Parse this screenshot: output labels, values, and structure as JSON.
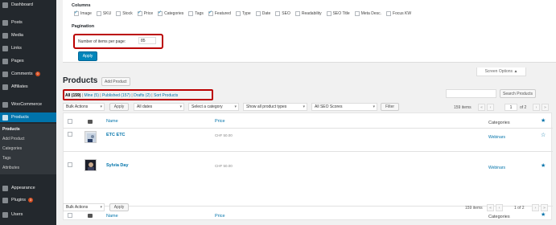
{
  "sidebar": {
    "items": [
      {
        "label": "Dashboard",
        "icon": "dashboard-icon"
      },
      {
        "label": "Posts",
        "icon": "pin-icon"
      },
      {
        "label": "Media",
        "icon": "media-icon"
      },
      {
        "label": "Links",
        "icon": "link-icon"
      },
      {
        "label": "Pages",
        "icon": "pages-icon"
      },
      {
        "label": "Comments",
        "icon": "comment-icon",
        "badge": "0"
      },
      {
        "label": "Affiliates",
        "icon": "affiliates-icon"
      },
      {
        "label": "WooCommerce",
        "icon": "woocommerce-icon"
      },
      {
        "label": "Products",
        "icon": "products-icon"
      },
      {
        "label": "Appearance",
        "icon": "appearance-icon"
      },
      {
        "label": "Plugins",
        "icon": "plugins-icon",
        "badge": "3"
      },
      {
        "label": "Users",
        "icon": "users-icon"
      }
    ],
    "submenu": [
      "Products",
      "Add Product",
      "Categories",
      "Tags",
      "Attributes"
    ]
  },
  "screen_options": {
    "columns_heading": "Columns",
    "columns": [
      {
        "label": "Image",
        "checked": true
      },
      {
        "label": "SKU",
        "checked": false
      },
      {
        "label": "Stock",
        "checked": false
      },
      {
        "label": "Price",
        "checked": true
      },
      {
        "label": "Categories",
        "checked": true
      },
      {
        "label": "Tags",
        "checked": false
      },
      {
        "label": "Featured",
        "checked": true
      },
      {
        "label": "Type",
        "checked": false
      },
      {
        "label": "Date",
        "checked": false
      },
      {
        "label": "SEO",
        "checked": false
      },
      {
        "label": "Readability",
        "checked": false
      },
      {
        "label": "SEO Title",
        "checked": false
      },
      {
        "label": "Meta Desc.",
        "checked": false
      },
      {
        "label": "Focus KW",
        "checked": false
      }
    ],
    "pagination_heading": "Pagination",
    "per_page_label": "Number of items per page:",
    "per_page_value": "85",
    "apply_label": "Apply",
    "tab_label": "Screen Options ▲"
  },
  "header": {
    "title": "Products",
    "add_button": "Add Product"
  },
  "views": {
    "all": "All (159)",
    "mine": "Mine (5)",
    "published": "Published (157)",
    "drafts": "Drafts (2)",
    "sort": "Sort Products",
    "sep": " | "
  },
  "search_button": "Search Products",
  "filters": {
    "bulk_actions": "Bulk Actions",
    "apply": "Apply",
    "dates": "All dates",
    "category": "Select a category",
    "product_types": "Show all product types",
    "seo_scores": "All SEO Scores",
    "filter": "Filter"
  },
  "pagination": {
    "items_label": "159 items",
    "current_page": "1",
    "of_pages": "of 2",
    "bottom_pages": "1 of 2",
    "first": "«",
    "prev": "‹",
    "next": "›",
    "last": "»"
  },
  "table": {
    "columns": {
      "name": "Name",
      "price": "Price",
      "categories": "Categories"
    },
    "rows": [
      {
        "name": "ETC ETC",
        "price": "CHF 50.00",
        "category": "Webinars",
        "featured": false
      },
      {
        "name": "Sylvia Day",
        "price": "CHF 50.00",
        "category": "Webinars",
        "featured": true
      }
    ]
  },
  "icons": {
    "featured_star": "★",
    "unfeatured_star": "☆",
    "image_column": "image-icon"
  },
  "colors": {
    "accent": "#0073aa",
    "sidebar": "#23282d",
    "highlight": "#b00000"
  }
}
